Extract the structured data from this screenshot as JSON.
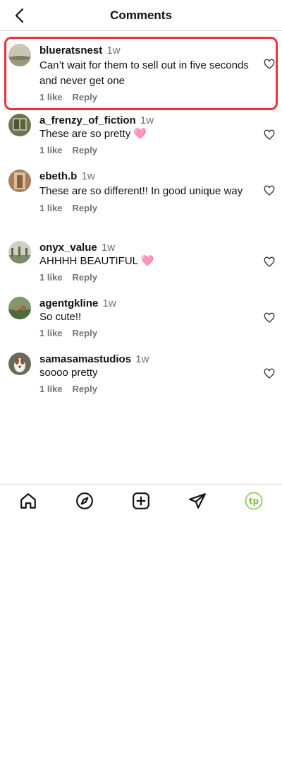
{
  "header": {
    "title": "Comments"
  },
  "comments": [
    {
      "username": "blueratsnest",
      "time": "1w",
      "text": "Can’t wait for them to sell out in five seconds and never get one",
      "likes": "1 like",
      "reply": "Reply"
    },
    {
      "username": "a_frenzy_of_fiction",
      "time": "1w",
      "text": "These are so pretty 🩷",
      "likes": "1 like",
      "reply": "Reply"
    },
    {
      "username": "ebeth.b",
      "time": "1w",
      "text": "These are so different!! In good unique way",
      "likes": "1 like",
      "reply": "Reply"
    },
    {
      "username": "onyx_value",
      "time": "1w",
      "text": "AHHHH BEAUTIFUL 🩷",
      "likes": "1 like",
      "reply": "Reply"
    },
    {
      "username": "agentgkline",
      "time": "1w",
      "text": "So cute!!",
      "likes": "1 like",
      "reply": "Reply"
    },
    {
      "username": "samasamastudios",
      "time": "1w",
      "text": "soooo pretty",
      "likes": "1 like",
      "reply": "Reply"
    }
  ],
  "nav": {
    "items": [
      "home-icon",
      "explore-compass-icon",
      "create-plus-icon",
      "send-paper-plane-icon",
      "profile-logo-icon"
    ],
    "profile_logo_text": "tp",
    "profile_logo_color": "#7ac142"
  },
  "colors": {
    "highlight": "#e8323d",
    "secondary_text": "#737373"
  }
}
